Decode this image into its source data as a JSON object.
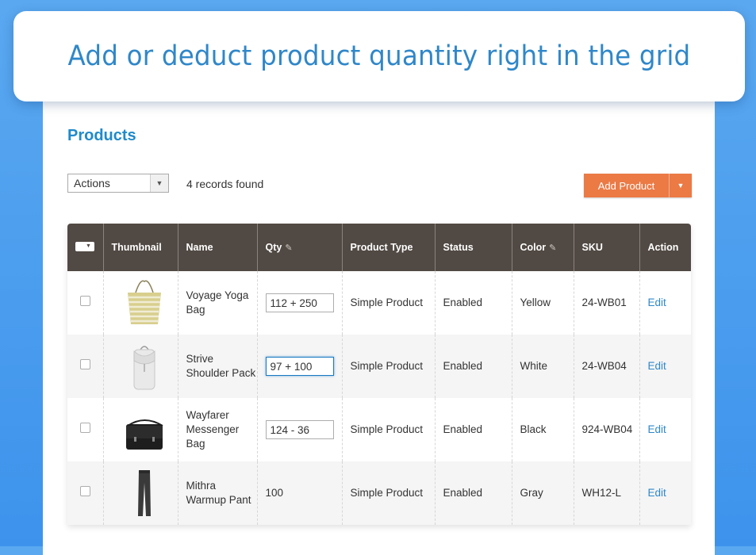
{
  "banner": {
    "text": "Add or deduct product quantity right in the grid"
  },
  "page": {
    "title": "Products"
  },
  "toolbar": {
    "actions_label": "Actions",
    "records_found": "4 records found",
    "add_product_label": "Add Product"
  },
  "grid": {
    "columns": [
      "Thumbnail",
      "Name",
      "Qty",
      "Product Type",
      "Status",
      "Color",
      "SKU",
      "Action"
    ],
    "rows": [
      {
        "name": "Voyage Yoga Bag",
        "qty": "112 + 250",
        "qty_editable": true,
        "type": "Simple Product",
        "status": "Enabled",
        "color": "Yellow",
        "sku": "24-WB01",
        "action": "Edit",
        "thumb": "yoga-bag"
      },
      {
        "name": "Strive Shoulder Pack",
        "qty": "97 + 100",
        "qty_editable": true,
        "type": "Simple Product",
        "status": "Enabled",
        "color": "White",
        "sku": "24-WB04",
        "action": "Edit",
        "thumb": "shoulder-pack"
      },
      {
        "name": "Wayfarer Messenger Bag",
        "qty": "124 - 36",
        "qty_editable": true,
        "type": "Simple Product",
        "status": "Enabled",
        "color": "Black",
        "sku": "924-WB04",
        "action": "Edit",
        "thumb": "messenger-bag"
      },
      {
        "name": "Mithra Warmup Pant",
        "qty": "100",
        "qty_editable": false,
        "type": "Simple Product",
        "status": "Enabled",
        "color": "Gray",
        "sku": "WH12-L",
        "action": "Edit",
        "thumb": "pant"
      }
    ]
  },
  "colors": {
    "header_bg": "#514943",
    "accent_blue": "#1f8acb",
    "button_orange": "#eb7a45",
    "background_blue": "#3d93ec"
  }
}
